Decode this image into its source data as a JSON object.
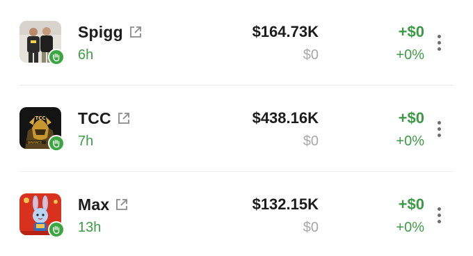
{
  "accounts": [
    {
      "name": "Spigg",
      "age": "6h",
      "value": "$164.73K",
      "sub_value": "$0",
      "change": "+$0",
      "change_pct": "+0%",
      "avatar": "photo-two-people"
    },
    {
      "name": "TCC",
      "age": "7h",
      "value": "$438.16K",
      "sub_value": "$0",
      "change": "+$0",
      "change_pct": "+0%",
      "avatar": "gold-warrior-binance"
    },
    {
      "name": "Max",
      "age": "13h",
      "value": "$132.15K",
      "sub_value": "$0",
      "change": "+$0",
      "change_pct": "+0%",
      "avatar": "bunny-character"
    }
  ],
  "icons": {
    "external_link": "external-link-icon",
    "wave_badge": "wave-hand-icon",
    "more": "more-vertical-icon"
  },
  "colors": {
    "positive": "#3d9a44",
    "muted": "#a7a7a7",
    "text": "#1c1c1c",
    "badge": "#3aa63f"
  }
}
